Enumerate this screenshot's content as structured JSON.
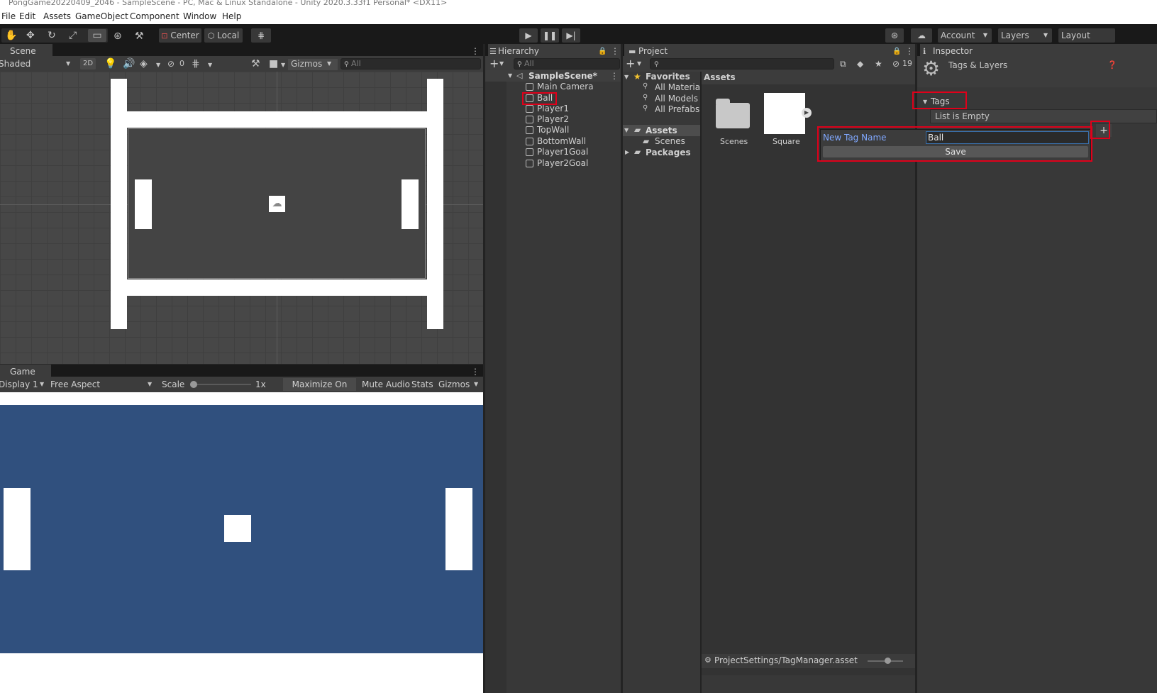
{
  "window": {
    "title": "PongGame20220409_2046 - SampleScene - PC, Mac & Linux Standalone - Unity 2020.3.33f1 Personal* <DX11>"
  },
  "menu": [
    "File",
    "Edit",
    "Assets",
    "GameObject",
    "Component",
    "Window",
    "Help"
  ],
  "toolbar": {
    "pivot": "Center",
    "space": "Local",
    "account": "Account",
    "layers": "Layers",
    "layout": "Layout"
  },
  "scene": {
    "tab": "Scene",
    "shading": "Shaded",
    "mode2d": "2D",
    "hidden_count": "0",
    "gizmos": "Gizmos",
    "search_placeholder": "All"
  },
  "game": {
    "tab": "Game",
    "display": "Display 1",
    "aspect": "Free Aspect",
    "scale_label": "Scale",
    "scale_value": "1x",
    "scale_fraction": 0.0,
    "maximize": "Maximize On Play",
    "mute": "Mute Audio",
    "stats": "Stats",
    "gizmos": "Gizmos",
    "background": "#30507e"
  },
  "hierarchy": {
    "tab": "Hierarchy",
    "search_placeholder": "All",
    "scene_name": "SampleScene*",
    "items": [
      "Main Camera",
      "Ball",
      "Player1",
      "Player2",
      "TopWall",
      "BottomWall",
      "Player1Goal",
      "Player2Goal"
    ]
  },
  "project": {
    "tab": "Project",
    "hidden_count": "19",
    "favorites_label": "Favorites",
    "favorites": [
      "All Materials",
      "All Models",
      "All Prefabs"
    ],
    "assets_label": "Assets",
    "assets_children": [
      "Scenes"
    ],
    "packages_label": "Packages",
    "breadcrumb": "Assets",
    "grid_items": [
      "Scenes",
      "Square"
    ],
    "status_path": "ProjectSettings/TagManager.asset"
  },
  "inspector": {
    "tab": "Inspector",
    "header": "Tags & Layers",
    "tags_label": "Tags",
    "list_empty": "List is Empty",
    "add_symbol": "+",
    "new_tag_label": "New Tag Name",
    "new_tag_value": "Ball",
    "save_label": "Save"
  },
  "colors": {
    "highlight": "#e0001a",
    "link_blue": "#80a8ff",
    "selection": "#3a72b0"
  }
}
